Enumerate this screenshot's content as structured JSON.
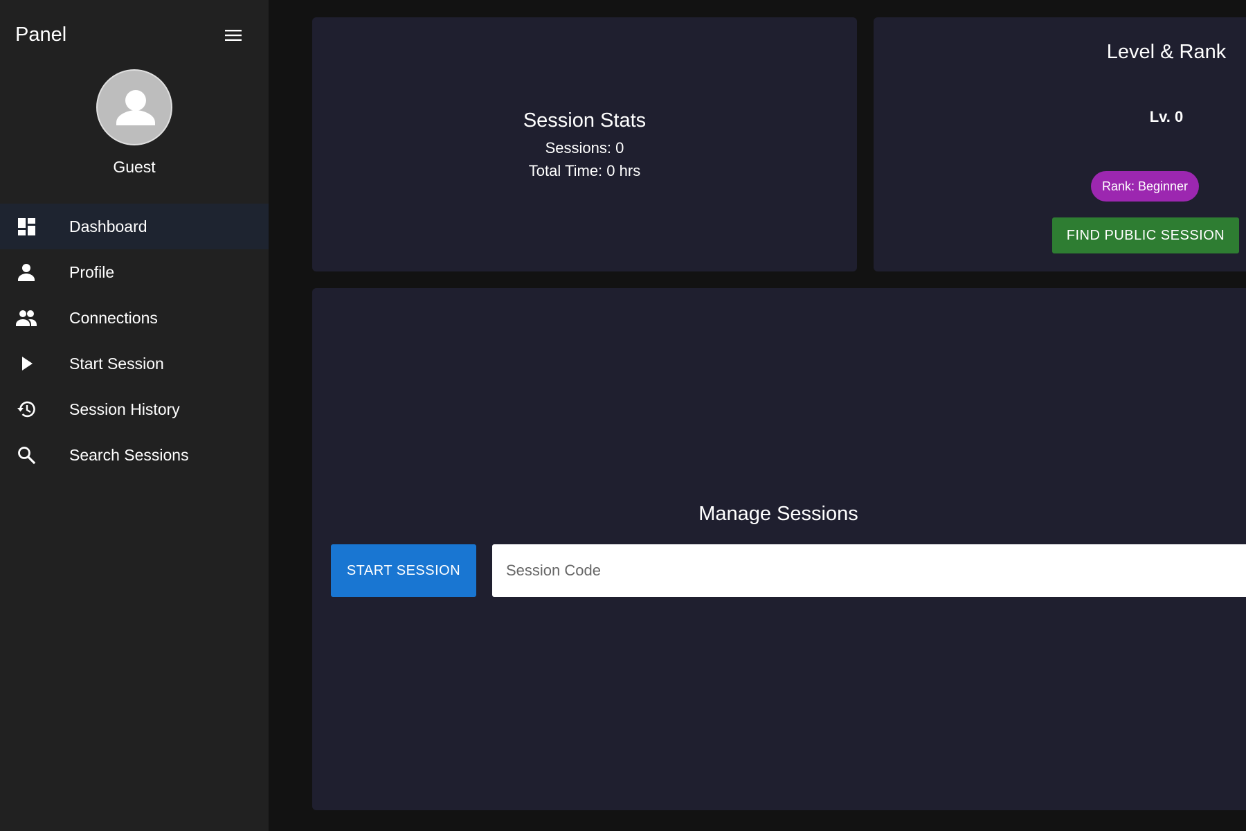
{
  "sidebar": {
    "title": "Panel",
    "menu_icon": "menu-icon",
    "user": {
      "name": "Guest",
      "avatar_icon": "person-icon"
    },
    "items": [
      {
        "label": "Dashboard",
        "icon": "dashboard-icon",
        "active": true
      },
      {
        "label": "Profile",
        "icon": "person-icon",
        "active": false
      },
      {
        "label": "Connections",
        "icon": "people-icon",
        "active": false
      },
      {
        "label": "Start Session",
        "icon": "play-icon",
        "active": false
      },
      {
        "label": "Session History",
        "icon": "history-icon",
        "active": false
      },
      {
        "label": "Search Sessions",
        "icon": "search-icon",
        "active": false
      }
    ]
  },
  "stats": {
    "title": "Session Stats",
    "sessions": "Sessions: 0",
    "total_time": "Total Time: 0 hrs"
  },
  "rank": {
    "title": "Level & Rank",
    "level": "Lv. 0",
    "badge": "Rank: Beginner",
    "find_button": "FIND PUBLIC SESSION"
  },
  "manage": {
    "title": "Manage Sessions",
    "start_button": "START SESSION",
    "code_placeholder": "Session Code",
    "code_value": ""
  },
  "colors": {
    "background": "#121212",
    "sidebar": "#212121",
    "card": "#1f1f2f",
    "active_nav": "#1e2430",
    "primary_button": "#1976d2",
    "success_button": "#2e7d32",
    "rank_badge": "#9c27b0"
  }
}
